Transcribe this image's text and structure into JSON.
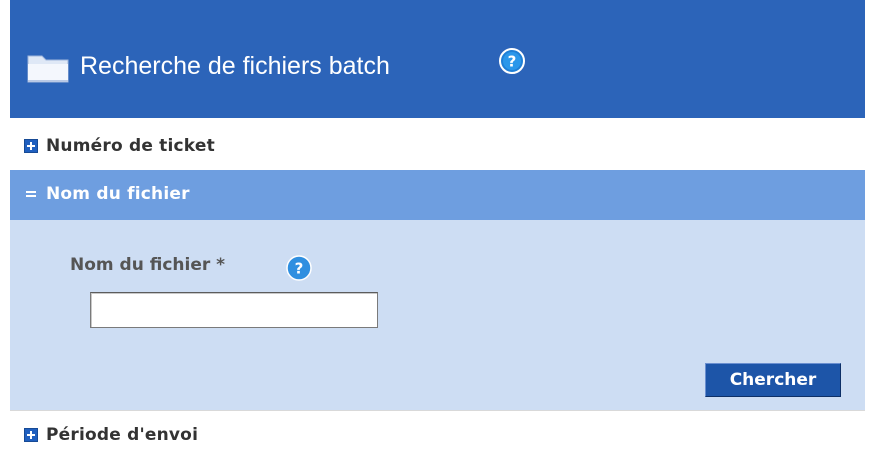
{
  "header": {
    "title": "Recherche de fichiers batch",
    "folder_icon": "folder-icon",
    "help_icon": "help-icon",
    "background": "#2c64b9"
  },
  "sections": [
    {
      "label": "Numéro de ticket",
      "state": "collapsed",
      "toggle_icon": "plus-icon"
    },
    {
      "label": "Nom du fichier",
      "state": "expanded",
      "toggle_icon": "minus-icon"
    },
    {
      "label": "Période d'envoi",
      "state": "collapsed",
      "toggle_icon": "plus-icon"
    }
  ],
  "form": {
    "file_name_label": "Nom du fichier *",
    "file_name_value": "",
    "help_icon": "help-icon",
    "search_button_label": "Chercher"
  },
  "colors": {
    "header": "#2c64b9",
    "active_section": "#6e9ee0",
    "form_background": "#cdddf3",
    "button": "#1d55a8"
  }
}
